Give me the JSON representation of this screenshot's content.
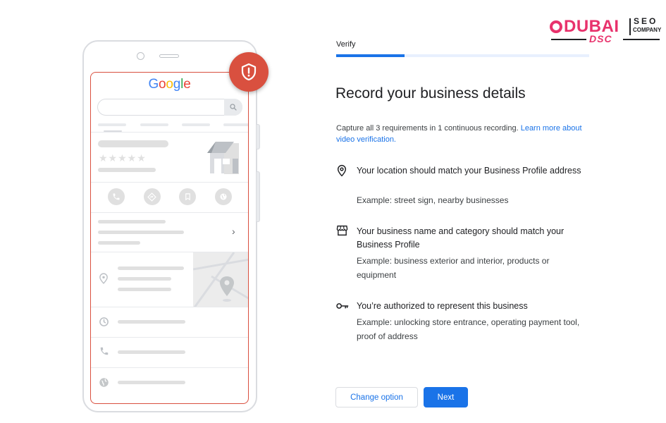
{
  "illustration": {
    "google_logo": [
      "G",
      "o",
      "o",
      "g",
      "l",
      "e"
    ],
    "icons": {
      "shield": "shield-alert-icon",
      "search": "search-icon",
      "store": "storefront-icon",
      "phone": "phone-icon",
      "directions": "directions-icon",
      "save": "bookmark-icon",
      "website": "globe-icon",
      "location": "location-pin-icon",
      "hours": "clock-icon"
    },
    "stars": "★★★★★",
    "chevron": "›"
  },
  "brand": {
    "dubai": "DUBAI",
    "seo": "SEO",
    "company": "COMPANY",
    "dsc": "DSC",
    "color": "#e8326c"
  },
  "header": {
    "tab_label": "Verify",
    "progress": 0.27
  },
  "main": {
    "title": "Record your business details",
    "subtitle_text": "Capture all 3 requirements in 1 continuous recording. ",
    "subtitle_link": "Learn more about video verification.",
    "requirements": [
      {
        "icon": "location-pin-icon",
        "title": "Your location should match your Business Profile address",
        "example": "Example: street sign, nearby businesses"
      },
      {
        "icon": "storefront-icon",
        "title": "Your business name and category should match your Business Profile",
        "example": "Example: business exterior and interior, products or equipment"
      },
      {
        "icon": "key-icon",
        "title": "You’re authorized to represent this business",
        "example": "Example: unlocking store entrance, operating payment tool, proof of address"
      }
    ]
  },
  "actions": {
    "change_option": "Change option",
    "next": "Next"
  },
  "colors": {
    "accent": "#1a73e8",
    "badge": "#d9503f"
  }
}
